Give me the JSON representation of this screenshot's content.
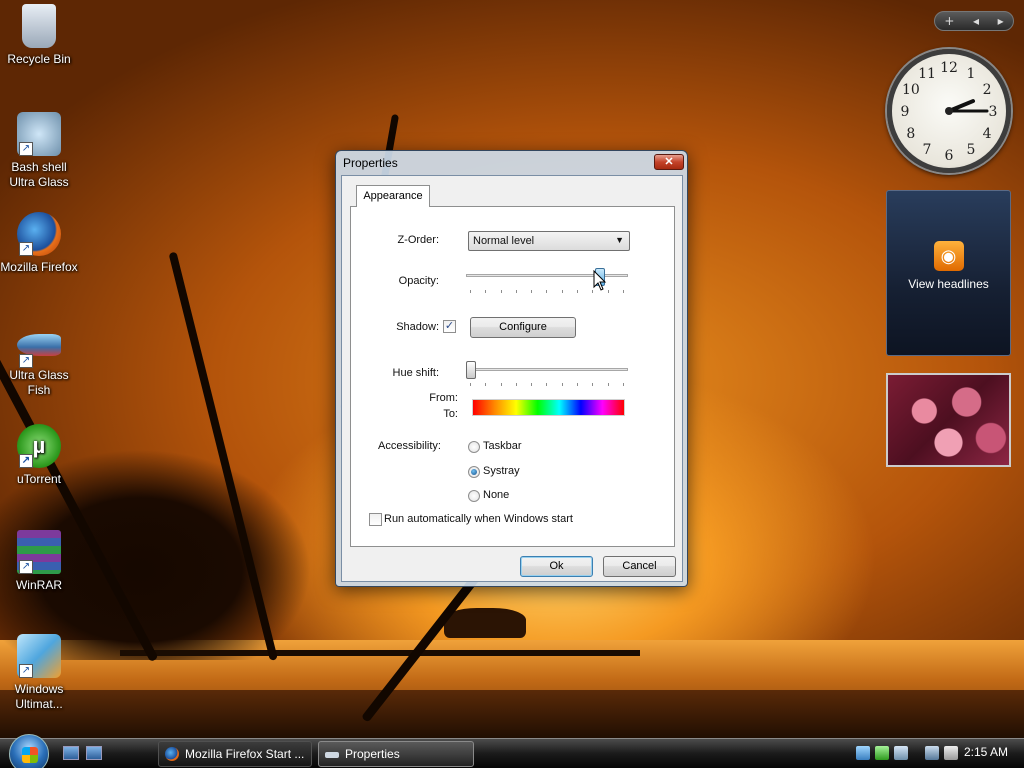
{
  "desktop": {
    "icons": [
      {
        "label": "Recycle Bin"
      },
      {
        "label": "Bash shell Ultra Glass"
      },
      {
        "label": "Mozilla Firefox"
      },
      {
        "label": "Ultra Glass Fish"
      },
      {
        "label": "uTorrent"
      },
      {
        "label": "WinRAR"
      },
      {
        "label": "Windows Ultimat..."
      }
    ]
  },
  "gadgets": {
    "bar": {
      "add": "+",
      "prev": "◂",
      "next": "▸"
    },
    "clock": {
      "hour": 2,
      "minute": 15,
      "numerals": [
        "12",
        "1",
        "2",
        "3",
        "4",
        "5",
        "6",
        "7",
        "8",
        "9",
        "10",
        "11"
      ]
    },
    "feed": {
      "label": "View headlines",
      "icon": "rss-icon"
    }
  },
  "dialog": {
    "title": "Properties",
    "close_label": "✕",
    "tab": "Appearance",
    "z_order": {
      "label": "Z-Order:",
      "value": "Normal level"
    },
    "opacity": {
      "label": "Opacity:",
      "fraction": 0.85
    },
    "shadow": {
      "label": "Shadow:",
      "checked": true,
      "check_glyph": "✓",
      "configure_label": "Configure"
    },
    "hue_shift": {
      "label": "Hue shift:",
      "fraction": 0.0
    },
    "from_label": "From:",
    "to_label": "To:",
    "accessibility": {
      "label": "Accessibility:",
      "options": [
        {
          "label": "Taskbar",
          "selected": false
        },
        {
          "label": "Systray",
          "selected": true
        },
        {
          "label": "None",
          "selected": false
        }
      ]
    },
    "autorun": {
      "label": "Run automatically when Windows start",
      "checked": false
    },
    "ok_label": "Ok",
    "cancel_label": "Cancel"
  },
  "taskbar": {
    "tasks": [
      {
        "label": "Mozilla Firefox Start ...",
        "active": false
      },
      {
        "label": "Properties",
        "active": true
      }
    ],
    "time": "2:15 AM"
  },
  "colors": {
    "accent": "#3c7fb1",
    "close_button": "#c4432a",
    "rss": "#f08c00"
  }
}
